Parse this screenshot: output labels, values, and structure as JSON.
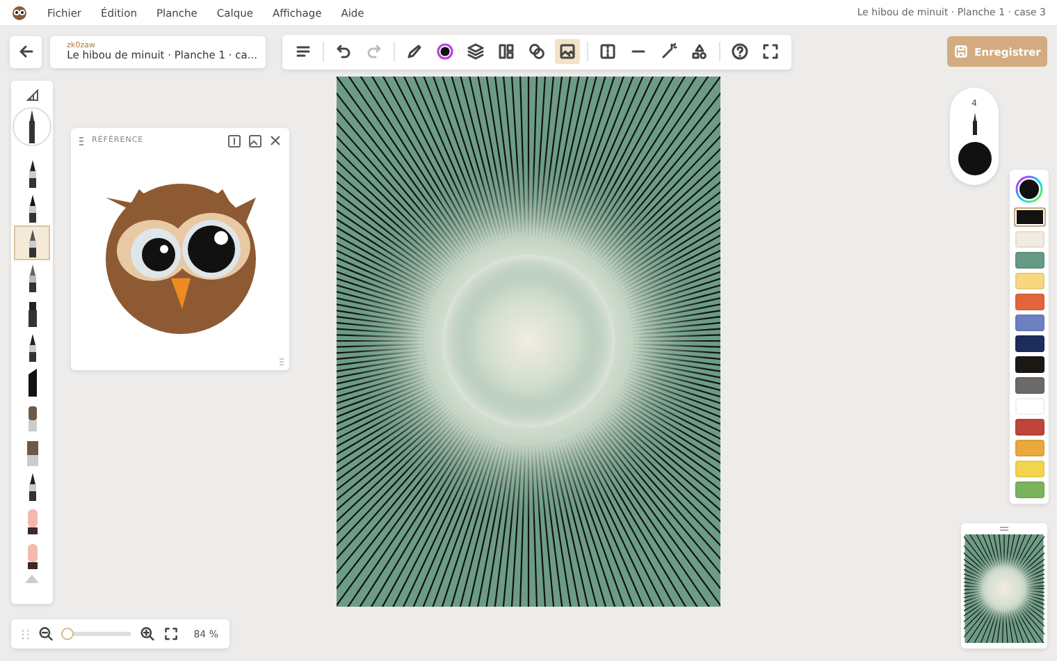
{
  "menu": [
    "Fichier",
    "Édition",
    "Planche",
    "Calque",
    "Affichage",
    "Aide"
  ],
  "window_title": "Le hibou de minuit · Planche 1 · case 3",
  "project": {
    "user": "zk0zaw",
    "title": "Le hibou de minuit · Planche 1 · ca..."
  },
  "toolbar": [
    [
      {
        "selected": false,
        "disabled": false
      }
    ],
    [
      {
        "selected": false,
        "disabled": false
      },
      {
        "selected": false,
        "disabled": true
      }
    ],
    [
      {
        "selected": false,
        "disabled": false
      },
      {
        "selected": false,
        "disabled": false
      },
      {
        "selected": false,
        "disabled": false
      },
      {
        "selected": false,
        "disabled": false
      },
      {
        "selected": false,
        "disabled": false
      },
      {
        "selected": true,
        "disabled": false
      }
    ],
    [
      {
        "selected": false,
        "disabled": false
      },
      {
        "selected": false,
        "disabled": false
      },
      {
        "selected": false,
        "disabled": false
      },
      {
        "selected": false,
        "disabled": false
      }
    ],
    [
      {
        "selected": false,
        "disabled": false
      },
      {
        "selected": false,
        "disabled": false
      }
    ]
  ],
  "save_button": "Enregistrer",
  "tools": [
    {
      "selected": false
    },
    {
      "selected": false
    },
    {
      "selected": true
    },
    {
      "selected": false
    },
    {
      "selected": false
    },
    {
      "selected": false
    },
    {
      "selected": false
    },
    {
      "selected": false
    },
    {
      "selected": false
    },
    {
      "selected": false
    },
    {
      "selected": false
    },
    {
      "selected": false
    }
  ],
  "reference_panel": {
    "title": "RÉFÉRENCE"
  },
  "brush_size": "4",
  "palette": [
    {
      "color": "#141210",
      "selected": true
    },
    {
      "color": "#f1ebe1",
      "selected": false
    },
    {
      "color": "#659a84",
      "selected": false
    },
    {
      "color": "#f9d77f",
      "selected": false
    },
    {
      "color": "#e4643b",
      "selected": false
    },
    {
      "color": "#6c80c2",
      "selected": false
    },
    {
      "color": "#1d2c5a",
      "selected": false
    },
    {
      "color": "#1a1715",
      "selected": false
    },
    {
      "color": "#6b6a68",
      "selected": false
    },
    {
      "color": "#ffffff",
      "selected": false
    },
    {
      "color": "#bf4538",
      "selected": false
    },
    {
      "color": "#e9a93b",
      "selected": false
    },
    {
      "color": "#f3d54d",
      "selected": false
    },
    {
      "color": "#7bb35d",
      "selected": false
    }
  ],
  "zoom": {
    "level": 0.06,
    "reading": "84 %"
  }
}
